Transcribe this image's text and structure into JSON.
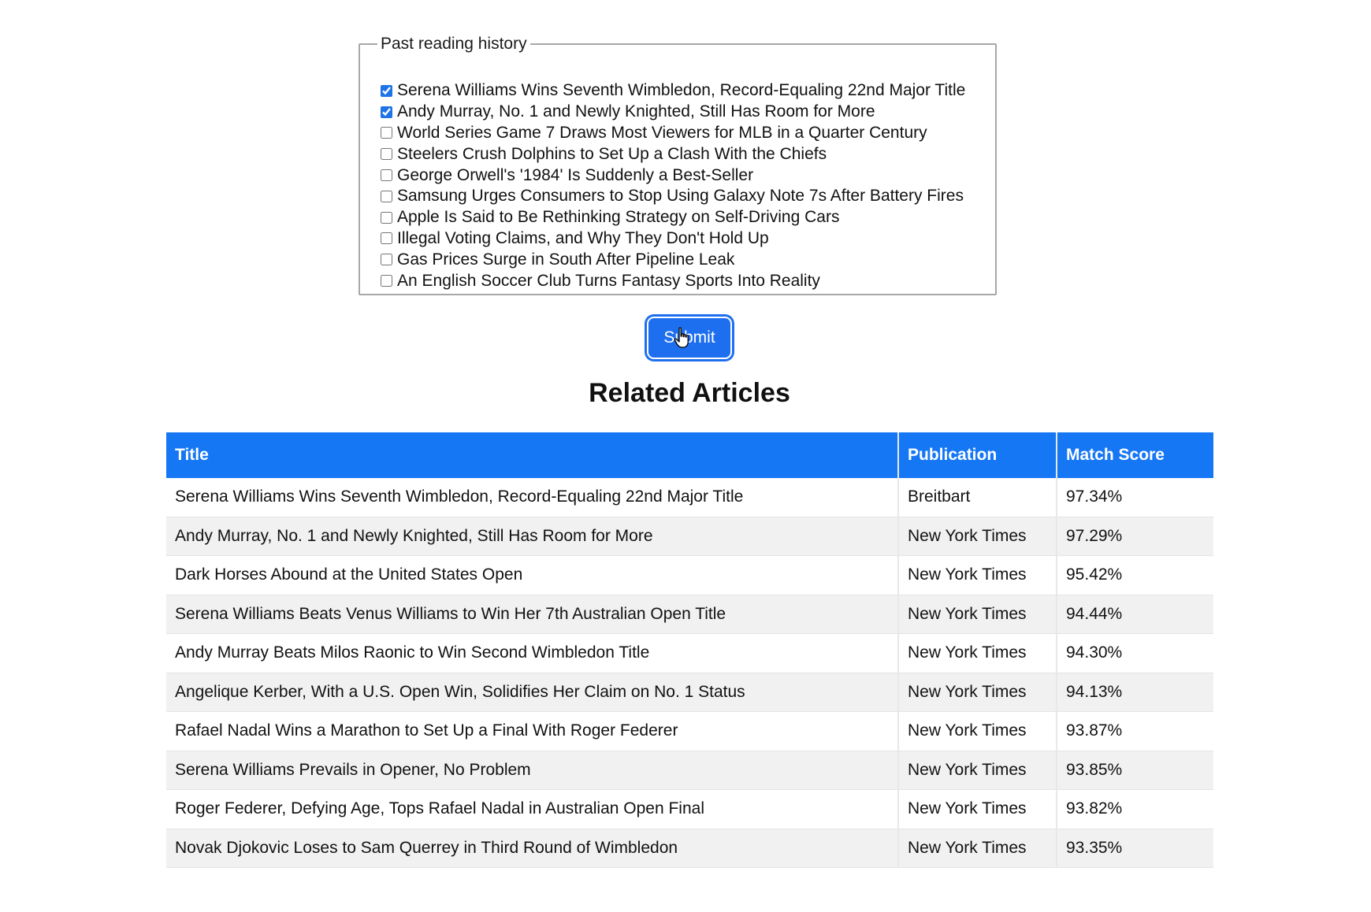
{
  "history": {
    "legend": "Past reading history",
    "items": [
      {
        "label": "Serena Williams Wins Seventh Wimbledon, Record-Equaling 22nd Major Title",
        "checked": true
      },
      {
        "label": "Andy Murray, No. 1 and Newly Knighted, Still Has Room for More",
        "checked": true
      },
      {
        "label": "World Series Game 7 Draws Most Viewers for MLB in a Quarter Century",
        "checked": false
      },
      {
        "label": "Steelers Crush Dolphins to Set Up a Clash With the Chiefs",
        "checked": false
      },
      {
        "label": "George Orwell's '1984' Is Suddenly a Best-Seller",
        "checked": false
      },
      {
        "label": "Samsung Urges Consumers to Stop Using Galaxy Note 7s After Battery Fires",
        "checked": false
      },
      {
        "label": "Apple Is Said to Be Rethinking Strategy on Self-Driving Cars",
        "checked": false
      },
      {
        "label": "Illegal Voting Claims, and Why They Don't Hold Up",
        "checked": false
      },
      {
        "label": "Gas Prices Surge in South After Pipeline Leak",
        "checked": false
      },
      {
        "label": "An English Soccer Club Turns Fantasy Sports Into Reality",
        "checked": false
      }
    ]
  },
  "submit_label": "Submit",
  "related": {
    "heading": "Related Articles",
    "columns": [
      "Title",
      "Publication",
      "Match Score"
    ],
    "rows": [
      [
        "Serena Williams Wins Seventh Wimbledon, Record-Equaling 22nd Major Title",
        "Breitbart",
        "97.34%"
      ],
      [
        "Andy Murray, No. 1 and Newly Knighted, Still Has Room for More",
        "New York Times",
        "97.29%"
      ],
      [
        "Dark Horses Abound at the United States Open",
        "New York Times",
        "95.42%"
      ],
      [
        "Serena Williams Beats Venus Williams to Win Her 7th Australian Open Title",
        "New York Times",
        "94.44%"
      ],
      [
        "Andy Murray Beats Milos Raonic to Win Second Wimbledon Title",
        "New York Times",
        "94.30%"
      ],
      [
        "Angelique Kerber, With a U.S. Open Win, Solidifies Her Claim on No. 1 Status",
        "New York Times",
        "94.13%"
      ],
      [
        "Rafael Nadal Wins a Marathon to Set Up a Final With Roger Federer",
        "New York Times",
        "93.87%"
      ],
      [
        "Serena Williams Prevails in Opener, No Problem",
        "New York Times",
        "93.85%"
      ],
      [
        "Roger Federer, Defying Age, Tops Rafael Nadal in Australian Open Final",
        "New York Times",
        "93.82%"
      ],
      [
        "Novak Djokovic Loses to Sam Querrey in Third Round of Wimbledon",
        "New York Times",
        "93.35%"
      ]
    ]
  },
  "colors": {
    "accent": "#1677f5",
    "button": "#1e6ff0"
  }
}
